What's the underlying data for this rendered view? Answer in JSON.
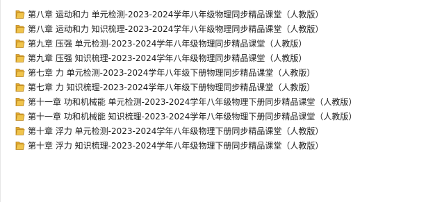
{
  "file_list": {
    "items": [
      {
        "name": "第八章 运动和力 单元检测-2023-2024学年八年级物理同步精品课堂（人教版）",
        "icon": "folder-icon"
      },
      {
        "name": "第八章 运动和力 知识梳理-2023-2024学年八年级物理同步精品课堂（人教版）",
        "icon": "folder-icon"
      },
      {
        "name": "第九章 压强 单元检测-2023-2024学年八年级物理同步精品课堂（人教版）",
        "icon": "folder-icon"
      },
      {
        "name": "第九章 压强 知识梳理-2023-2024学年八年级物理同步精品课堂（人教版）",
        "icon": "folder-icon"
      },
      {
        "name": "第七章 力 单元检测-2023-2024学年八年级下册物理同步精品课堂（人教版）",
        "icon": "folder-icon"
      },
      {
        "name": "第七章 力 知识梳理-2023-2024学年八年级下册物理同步精品课堂（人教版）",
        "icon": "folder-icon"
      },
      {
        "name": "第十一章 功和机械能 单元检测-2023-2024学年八年级物理下册同步精品课堂（人教版）",
        "icon": "folder-icon"
      },
      {
        "name": "第十一章 功和机械能 知识梳理-2023-2024学年八年级物理下册同步精品课堂（人教版）",
        "icon": "folder-icon"
      },
      {
        "name": "第十章 浮力 单元检测-2023-2024学年八年级物理下册同步精品课堂（人教版）",
        "icon": "folder-icon"
      },
      {
        "name": "第十章 浮力 知识梳理-2023-2024学年八年级物理下册同步精品课堂（人教版）",
        "icon": "folder-icon"
      }
    ]
  },
  "colors": {
    "folder_body": "#f0c44c",
    "folder_tab": "#e2a92e",
    "folder_edge": "#b88420",
    "text": "#1e1e1e"
  }
}
